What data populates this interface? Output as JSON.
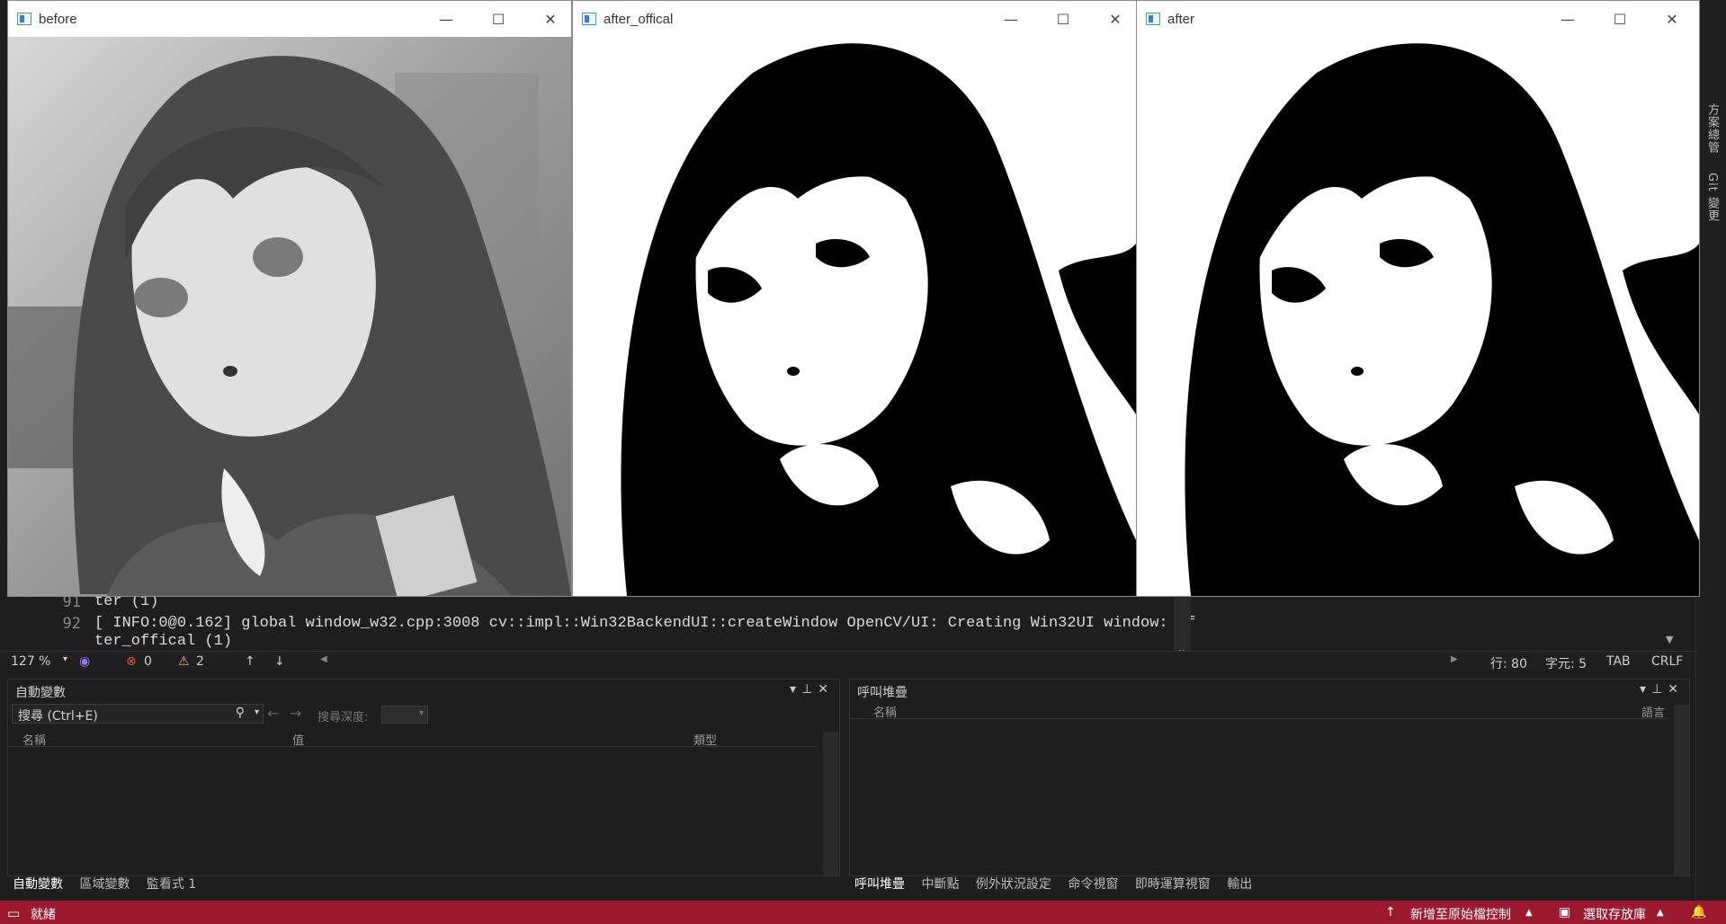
{
  "windows": [
    {
      "title": "before",
      "controls": {
        "min": "—",
        "max": "☐",
        "close": "✕"
      }
    },
    {
      "title": "after_offical",
      "controls": {
        "min": "—",
        "max": "☐",
        "close": "✕"
      }
    },
    {
      "title": "after",
      "controls": {
        "min": "—",
        "max": "☐",
        "close": "✕"
      }
    }
  ],
  "console": {
    "lines": [
      {
        "num": "91",
        "text": "ter (1)"
      },
      {
        "num": "92",
        "text": "[ INFO:0@0.162] global window_w32.cpp:3008 cv::impl::Win32BackendUI::createWindow OpenCV/UI: Creating Win32UI window: af"
      },
      {
        "num": "",
        "text": "ter_offical (1)"
      },
      {
        "num": "93",
        "text": ""
      }
    ]
  },
  "editor_status": {
    "zoom": "127 %",
    "errors": "0",
    "warnings": "2",
    "line": "行: 80",
    "char": "字元: 5",
    "indent": "TAB",
    "eol": "CRLF"
  },
  "right_strip": {
    "tab1": "方案總管",
    "tab2": "Git 變更"
  },
  "autos_panel": {
    "title": "自動變數",
    "search_placeholder": "搜尋 (Ctrl+E)",
    "depth_label": "搜尋深度:",
    "columns": [
      "名稱",
      "值",
      "類型"
    ],
    "tabs": [
      "自動變數",
      "區域變數",
      "監看式 1"
    ]
  },
  "callstack_panel": {
    "title": "呼叫堆疊",
    "columns": [
      "名稱",
      "語言"
    ],
    "tabs": [
      "呼叫堆疊",
      "中斷點",
      "例外狀況設定",
      "命令視窗",
      "即時運算視窗",
      "輸出"
    ]
  },
  "statusbar": {
    "ready": "就緒",
    "add_source": "新增至原始檔控制",
    "select_repo": "選取存放庫"
  },
  "colors": {
    "statusbar": "#9b1a2f",
    "background": "#1e1e1e"
  }
}
